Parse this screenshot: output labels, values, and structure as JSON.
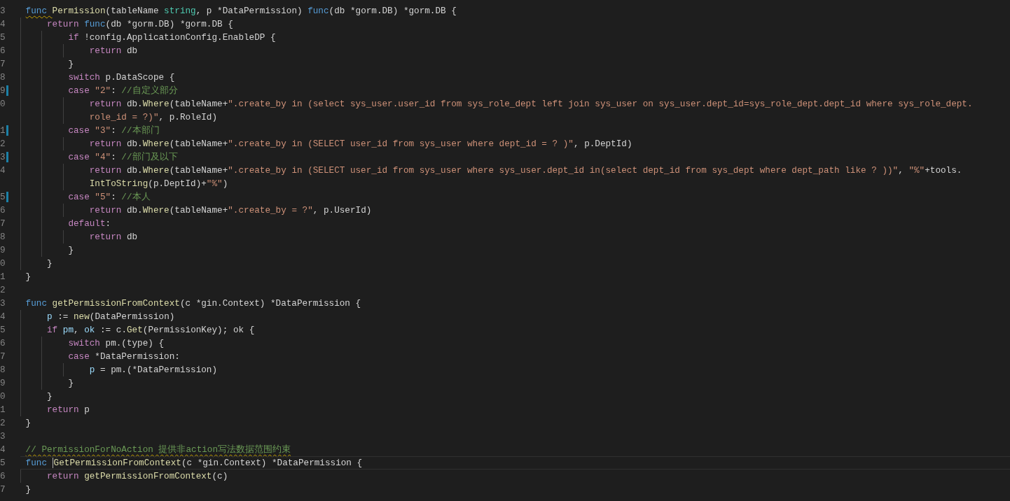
{
  "editor": {
    "rows": [
      {
        "n": "3",
        "indent": "",
        "modified": false,
        "current": false,
        "tokens": [
          {
            "kind": "keyword",
            "t": "func ",
            "warning": true
          },
          {
            "kind": "function",
            "t": "Permission"
          },
          {
            "kind": "plain",
            "t": "(tableName "
          },
          {
            "kind": "type",
            "t": "string"
          },
          {
            "kind": "plain",
            "t": ", p *DataPermission) "
          },
          {
            "kind": "keyword",
            "t": "func"
          },
          {
            "kind": "plain",
            "t": "(db *gorm.DB) *gorm.DB {"
          }
        ]
      },
      {
        "n": "4",
        "indent": "    ",
        "modified": false,
        "current": false,
        "tokens": [
          {
            "kind": "control",
            "t": "return "
          },
          {
            "kind": "keyword",
            "t": "func"
          },
          {
            "kind": "plain",
            "t": "(db *gorm.DB) *gorm.DB {"
          }
        ]
      },
      {
        "n": "5",
        "indent": "        ",
        "modified": false,
        "current": false,
        "tokens": [
          {
            "kind": "control",
            "t": "if"
          },
          {
            "kind": "plain",
            "t": " !config.ApplicationConfig.EnableDP {"
          }
        ]
      },
      {
        "n": "6",
        "indent": "            ",
        "modified": false,
        "current": false,
        "tokens": [
          {
            "kind": "control",
            "t": "return"
          },
          {
            "kind": "plain",
            "t": " db"
          }
        ]
      },
      {
        "n": "7",
        "indent": "        ",
        "modified": false,
        "current": false,
        "tokens": [
          {
            "kind": "plain",
            "t": "}"
          }
        ]
      },
      {
        "n": "8",
        "indent": "        ",
        "modified": false,
        "current": false,
        "tokens": [
          {
            "kind": "control",
            "t": "switch"
          },
          {
            "kind": "plain",
            "t": " p.DataScope {"
          }
        ]
      },
      {
        "n": "9",
        "indent": "        ",
        "modified": true,
        "current": false,
        "tokens": [
          {
            "kind": "control",
            "t": "case "
          },
          {
            "kind": "string",
            "t": "\"2\""
          },
          {
            "kind": "plain",
            "t": ": "
          },
          {
            "kind": "comment",
            "t": "//自定义部分"
          }
        ]
      },
      {
        "n": "0",
        "indent": "            ",
        "modified": false,
        "current": false,
        "tokens": [
          {
            "kind": "control",
            "t": "return"
          },
          {
            "kind": "plain",
            "t": " db."
          },
          {
            "kind": "function",
            "t": "Where"
          },
          {
            "kind": "plain",
            "t": "(tableName+"
          },
          {
            "kind": "string",
            "t": "\".create_by in (select sys_user.user_id from sys_role_dept left join sys_user on sys_user.dept_id=sys_role_dept.dept_id where sys_role_dept."
          }
        ]
      },
      {
        "indent": "            ",
        "modified": false,
        "current": false,
        "tokens": [
          {
            "kind": "string",
            "t": "role_id = ?)\""
          },
          {
            "kind": "plain",
            "t": ", p.RoleId)"
          }
        ]
      },
      {
        "n": "1",
        "indent": "        ",
        "modified": true,
        "current": false,
        "tokens": [
          {
            "kind": "control",
            "t": "case "
          },
          {
            "kind": "string",
            "t": "\"3\""
          },
          {
            "kind": "plain",
            "t": ": "
          },
          {
            "kind": "comment",
            "t": "//本部门"
          }
        ]
      },
      {
        "n": "2",
        "indent": "            ",
        "modified": false,
        "current": false,
        "tokens": [
          {
            "kind": "control",
            "t": "return"
          },
          {
            "kind": "plain",
            "t": " db."
          },
          {
            "kind": "function",
            "t": "Where"
          },
          {
            "kind": "plain",
            "t": "(tableName+"
          },
          {
            "kind": "string",
            "t": "\".create_by in (SELECT user_id from sys_user where dept_id = ? )\""
          },
          {
            "kind": "plain",
            "t": ", p.DeptId)"
          }
        ]
      },
      {
        "n": "3",
        "indent": "        ",
        "modified": true,
        "current": false,
        "tokens": [
          {
            "kind": "control",
            "t": "case "
          },
          {
            "kind": "string",
            "t": "\"4\""
          },
          {
            "kind": "plain",
            "t": ": "
          },
          {
            "kind": "comment",
            "t": "//部门及以下"
          }
        ]
      },
      {
        "n": "4",
        "indent": "            ",
        "modified": false,
        "current": false,
        "tokens": [
          {
            "kind": "control",
            "t": "return"
          },
          {
            "kind": "plain",
            "t": " db."
          },
          {
            "kind": "function",
            "t": "Where"
          },
          {
            "kind": "plain",
            "t": "(tableName+"
          },
          {
            "kind": "string",
            "t": "\".create_by in (SELECT user_id from sys_user where sys_user.dept_id in(select dept_id from sys_dept where dept_path like ? ))\""
          },
          {
            "kind": "plain",
            "t": ", "
          },
          {
            "kind": "string",
            "t": "\"%\""
          },
          {
            "kind": "plain",
            "t": "+tools."
          }
        ]
      },
      {
        "indent": "            ",
        "modified": false,
        "current": false,
        "tokens": [
          {
            "kind": "function",
            "t": "IntToString"
          },
          {
            "kind": "plain",
            "t": "(p.DeptId)+"
          },
          {
            "kind": "string",
            "t": "\"%\""
          },
          {
            "kind": "plain",
            "t": ")"
          }
        ]
      },
      {
        "n": "5",
        "indent": "        ",
        "modified": true,
        "current": false,
        "tokens": [
          {
            "kind": "control",
            "t": "case "
          },
          {
            "kind": "string",
            "t": "\"5\""
          },
          {
            "kind": "plain",
            "t": ": "
          },
          {
            "kind": "comment",
            "t": "//本人"
          }
        ]
      },
      {
        "n": "6",
        "indent": "            ",
        "modified": false,
        "current": false,
        "tokens": [
          {
            "kind": "control",
            "t": "return"
          },
          {
            "kind": "plain",
            "t": " db."
          },
          {
            "kind": "function",
            "t": "Where"
          },
          {
            "kind": "plain",
            "t": "(tableName+"
          },
          {
            "kind": "string",
            "t": "\".create_by = ?\""
          },
          {
            "kind": "plain",
            "t": ", p.UserId)"
          }
        ]
      },
      {
        "n": "7",
        "indent": "        ",
        "modified": false,
        "current": false,
        "tokens": [
          {
            "kind": "control",
            "t": "default"
          },
          {
            "kind": "plain",
            "t": ":"
          }
        ]
      },
      {
        "n": "8",
        "indent": "            ",
        "modified": false,
        "current": false,
        "tokens": [
          {
            "kind": "control",
            "t": "return"
          },
          {
            "kind": "plain",
            "t": " db"
          }
        ]
      },
      {
        "n": "9",
        "indent": "        ",
        "modified": false,
        "current": false,
        "tokens": [
          {
            "kind": "plain",
            "t": "}"
          }
        ]
      },
      {
        "n": "0",
        "indent": "    ",
        "modified": false,
        "current": false,
        "tokens": [
          {
            "kind": "plain",
            "t": "}"
          }
        ]
      },
      {
        "n": "1",
        "indent": "",
        "modified": false,
        "current": false,
        "tokens": [
          {
            "kind": "plain",
            "t": "}"
          }
        ]
      },
      {
        "n": "2",
        "indent": "",
        "modified": false,
        "current": false,
        "tokens": []
      },
      {
        "n": "3",
        "indent": "",
        "modified": false,
        "current": false,
        "tokens": [
          {
            "kind": "keyword",
            "t": "func "
          },
          {
            "kind": "function",
            "t": "getPermissionFromContext"
          },
          {
            "kind": "plain",
            "t": "(c *gin.Context) *DataPermission {"
          }
        ]
      },
      {
        "n": "4",
        "indent": "    ",
        "modified": false,
        "current": false,
        "tokens": [
          {
            "kind": "variable",
            "t": "p"
          },
          {
            "kind": "plain",
            "t": " := "
          },
          {
            "kind": "function",
            "t": "new"
          },
          {
            "kind": "plain",
            "t": "(DataPermission)"
          }
        ]
      },
      {
        "n": "5",
        "indent": "    ",
        "modified": false,
        "current": false,
        "tokens": [
          {
            "kind": "control",
            "t": "if "
          },
          {
            "kind": "variable",
            "t": "pm"
          },
          {
            "kind": "plain",
            "t": ", "
          },
          {
            "kind": "variable",
            "t": "ok"
          },
          {
            "kind": "plain",
            "t": " := c."
          },
          {
            "kind": "function",
            "t": "Get"
          },
          {
            "kind": "plain",
            "t": "(PermissionKey); ok {"
          }
        ]
      },
      {
        "n": "6",
        "indent": "        ",
        "modified": false,
        "current": false,
        "tokens": [
          {
            "kind": "control",
            "t": "switch"
          },
          {
            "kind": "plain",
            "t": " pm.(type) {"
          }
        ]
      },
      {
        "n": "7",
        "indent": "        ",
        "modified": false,
        "current": false,
        "tokens": [
          {
            "kind": "control",
            "t": "case"
          },
          {
            "kind": "plain",
            "t": " *DataPermission:"
          }
        ]
      },
      {
        "n": "8",
        "indent": "            ",
        "modified": false,
        "current": false,
        "tokens": [
          {
            "kind": "variable",
            "t": "p"
          },
          {
            "kind": "plain",
            "t": " = pm.(*DataPermission)"
          }
        ]
      },
      {
        "n": "9",
        "indent": "        ",
        "modified": false,
        "current": false,
        "tokens": [
          {
            "kind": "plain",
            "t": "}"
          }
        ]
      },
      {
        "n": "0",
        "indent": "    ",
        "modified": false,
        "current": false,
        "tokens": [
          {
            "kind": "plain",
            "t": "}"
          }
        ]
      },
      {
        "n": "1",
        "indent": "    ",
        "modified": false,
        "current": false,
        "tokens": [
          {
            "kind": "control",
            "t": "return"
          },
          {
            "kind": "plain",
            "t": " p"
          }
        ]
      },
      {
        "n": "2",
        "indent": "",
        "modified": false,
        "current": false,
        "tokens": [
          {
            "kind": "plain",
            "t": "}"
          }
        ]
      },
      {
        "n": "3",
        "indent": "",
        "modified": false,
        "current": false,
        "tokens": []
      },
      {
        "n": "4",
        "indent": "",
        "modified": false,
        "current": false,
        "tokens": [
          {
            "kind": "comment",
            "t": "// PermissionForNoAction 提供非action写法数据范围约束",
            "warning": true
          }
        ]
      },
      {
        "n": "5",
        "indent": "",
        "modified": false,
        "current": true,
        "tokens": [
          {
            "kind": "keyword",
            "t": "func "
          },
          {
            "kind": "function",
            "t": "GetPermissionFromContext",
            "cursor": true
          },
          {
            "kind": "plain",
            "t": "(c *gin.Context) *DataPermission {"
          }
        ]
      },
      {
        "n": "6",
        "indent": "    ",
        "modified": false,
        "current": false,
        "tokens": [
          {
            "kind": "control",
            "t": "return "
          },
          {
            "kind": "function",
            "t": "getPermissionFromContext"
          },
          {
            "kind": "plain",
            "t": "(c)"
          }
        ]
      },
      {
        "n": "7",
        "indent": "",
        "modified": false,
        "current": false,
        "tokens": [
          {
            "kind": "plain",
            "t": "}"
          }
        ]
      }
    ]
  }
}
